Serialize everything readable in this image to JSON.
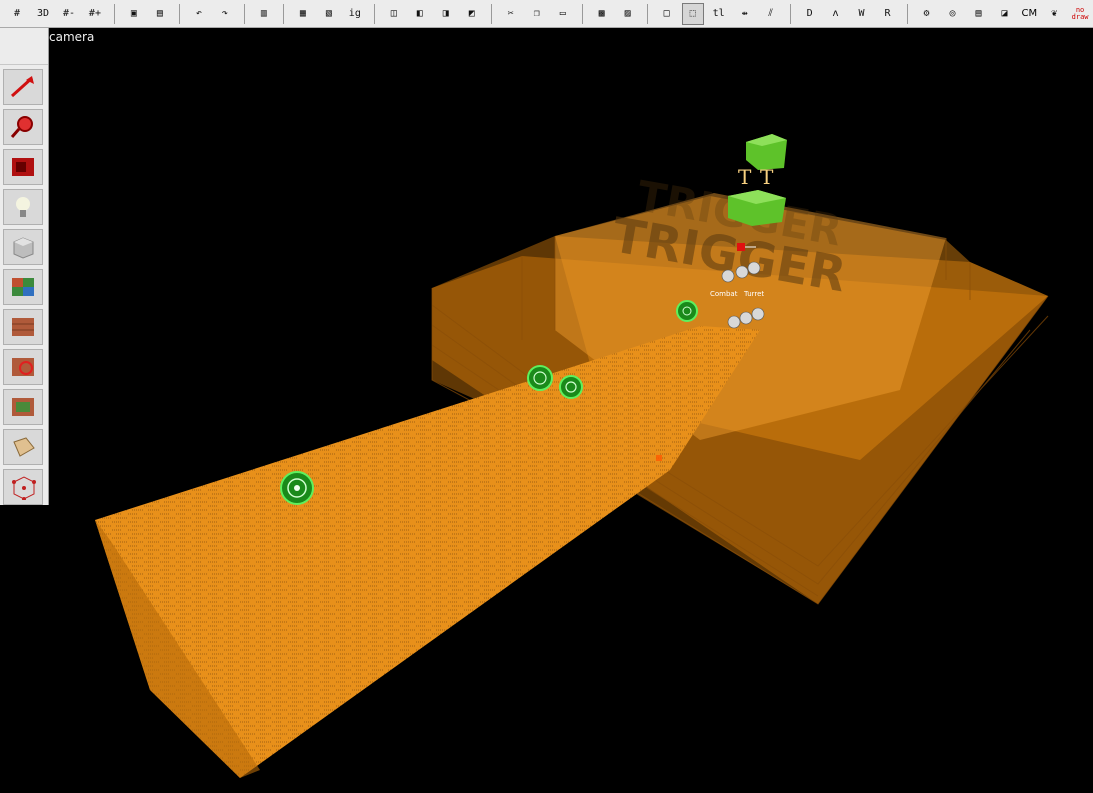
{
  "viewport": {
    "label": "camera",
    "trigger_text": "TRIGGER",
    "entity_labels": [
      "Combat",
      "Turret"
    ],
    "text_entities": [
      "T",
      "T"
    ]
  },
  "toolbar": {
    "text_cm": "CM",
    "text_nodraw_line1": "no",
    "text_nodraw_line2": "draw",
    "groups": [
      [
        "grid-toggle-icon",
        "3d-grid-icon",
        "grid-smaller-icon",
        "grid-larger-icon"
      ],
      [
        "clip-icon",
        "select-face-icon"
      ],
      [
        "undo-icon",
        "redo-icon"
      ],
      [
        "carve-icon",
        "group-icon",
        "ungroup-icon",
        "ignore-group-icon"
      ],
      [
        "hide-icon",
        "show-icon",
        "show-all-icon",
        "quick-hide-icon"
      ],
      [
        "cut-icon",
        "copy-icon",
        "paste-icon"
      ],
      [
        "texture-lock-icon",
        "texture-scale-icon"
      ],
      [
        "cordon-icon",
        "selection-box-icon",
        "tl-icon",
        "flip-icon",
        "alignment-icon"
      ],
      [
        "snap-icon",
        "wireframe-icon",
        "vertex-icon",
        "model-icon"
      ],
      [
        "compile-icon",
        "sphere-icon",
        "displacement-icon",
        "color-icon"
      ],
      [
        "leaf-icon",
        "nodraw-icon"
      ]
    ]
  },
  "leftpanel": {
    "tools": [
      "selection-tool-icon",
      "magnify-tool-icon",
      "camera-tool-icon",
      "entity-tool-icon",
      "block-tool-icon",
      "toggle-texture-tool-icon",
      "apply-decal-tool-icon",
      "apply-overlay-tool-icon",
      "clipping-tool-icon",
      "vertex-tool-icon",
      "path-tool-icon"
    ]
  }
}
